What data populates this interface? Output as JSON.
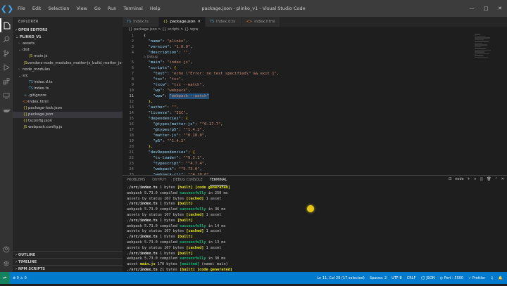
{
  "window": {
    "title": "package.json - plinko_v1 - Visual Studio Code",
    "controls": [
      "—",
      "□",
      "✕"
    ]
  },
  "menu": [
    "File",
    "Edit",
    "Selection",
    "View",
    "Go",
    "Run",
    "Terminal",
    "Help"
  ],
  "sidebar": {
    "header": "EXPLORER",
    "open_editors": "OPEN EDITORS",
    "project": "PLINKO_V1",
    "items": [
      {
        "label": "assets",
        "type": "folder",
        "open": false,
        "indent": 1
      },
      {
        "label": "dist",
        "type": "folder",
        "open": true,
        "indent": 1
      },
      {
        "label": "main.js",
        "type": "js",
        "indent": 2
      },
      {
        "label": "vendors-node_modules_matter-js_build_matter_js-node_mo...",
        "type": "js",
        "indent": 2
      },
      {
        "label": "node_modules",
        "type": "folder",
        "open": false,
        "indent": 1
      },
      {
        "label": "src",
        "type": "folder",
        "open": true,
        "indent": 1
      },
      {
        "label": "index.d.ts",
        "type": "ts",
        "indent": 2
      },
      {
        "label": "index.ts",
        "type": "ts",
        "indent": 2
      },
      {
        "label": ".gitignore",
        "type": "git",
        "indent": 1
      },
      {
        "label": "index.html",
        "type": "html",
        "indent": 1
      },
      {
        "label": "package-lock.json",
        "type": "json",
        "indent": 1
      },
      {
        "label": "package.json",
        "type": "json",
        "indent": 1,
        "selected": true
      },
      {
        "label": "tsconfig.json",
        "type": "json",
        "indent": 1
      },
      {
        "label": "webpack.config.js",
        "type": "js",
        "indent": 1
      }
    ],
    "outline": "OUTLINE",
    "timeline": "TIMELINE",
    "npm_scripts": "NPM SCRIPTS"
  },
  "tabs": [
    {
      "label": "index.ts",
      "icon": "TS",
      "active": false
    },
    {
      "label": "package.json",
      "icon": "{}",
      "active": true
    },
    {
      "label": "index.d.ts",
      "icon": "TS",
      "active": false
    },
    {
      "label": "index.html",
      "icon": "<>",
      "active": false
    }
  ],
  "breadcrumb": "{} package.json > {} scripts > {} wpw",
  "codelens": "▷ Debug",
  "code": [
    {
      "n": "1",
      "t": [
        [
          "p",
          "{"
        ]
      ]
    },
    {
      "n": "2",
      "t": [
        [
          "p",
          "  "
        ],
        [
          "k",
          "\"name\""
        ],
        [
          "p",
          ": "
        ],
        [
          "s",
          "\"plinko\""
        ],
        [
          "p",
          ","
        ]
      ]
    },
    {
      "n": "3",
      "t": [
        [
          "p",
          "  "
        ],
        [
          "k",
          "\"version\""
        ],
        [
          "p",
          ": "
        ],
        [
          "s",
          "\"1.0.0\""
        ],
        [
          "p",
          ","
        ]
      ]
    },
    {
      "n": "4",
      "t": [
        [
          "p",
          "  "
        ],
        [
          "k",
          "\"description\""
        ],
        [
          "p",
          ": "
        ],
        [
          "s",
          "\"\""
        ],
        [
          "p",
          ","
        ]
      ]
    },
    {
      "n": "5",
      "t": [
        [
          "p",
          "  "
        ],
        [
          "k",
          "\"main\""
        ],
        [
          "p",
          ": "
        ],
        [
          "s",
          "\"index.js\""
        ],
        [
          "p",
          ","
        ]
      ],
      "lens": true
    },
    {
      "n": "6",
      "t": [
        [
          "p",
          "  "
        ],
        [
          "k",
          "\"scripts\""
        ],
        [
          "p",
          ": "
        ],
        [
          "b2",
          "{"
        ]
      ]
    },
    {
      "n": "7",
      "t": [
        [
          "p",
          "    "
        ],
        [
          "k",
          "\"test\""
        ],
        [
          "p",
          ": "
        ],
        [
          "s",
          "\"echo \\\"Error: no test specified\\\" && exit 1\""
        ],
        [
          "p",
          ","
        ]
      ]
    },
    {
      "n": "8",
      "t": [
        [
          "p",
          "    "
        ],
        [
          "k",
          "\"tsc\""
        ],
        [
          "p",
          ": "
        ],
        [
          "s",
          "\"tsc\""
        ],
        [
          "p",
          ","
        ]
      ]
    },
    {
      "n": "9",
      "t": [
        [
          "p",
          "    "
        ],
        [
          "k",
          "\"tscw\""
        ],
        [
          "p",
          ": "
        ],
        [
          "s",
          "\"tsc --watch\""
        ],
        [
          "p",
          ","
        ]
      ]
    },
    {
      "n": "10",
      "t": [
        [
          "p",
          "    "
        ],
        [
          "k",
          "\"wp\""
        ],
        [
          "p",
          ": "
        ],
        [
          "s",
          "\"webpack\""
        ],
        [
          "p",
          ","
        ]
      ]
    },
    {
      "n": "11",
      "t": [
        [
          "p",
          "    "
        ],
        [
          "k",
          "\"wpw\""
        ],
        [
          "p",
          ": "
        ],
        [
          "sel",
          "\"webpack --watch\""
        ]
      ],
      "cur": true
    },
    {
      "n": "12",
      "t": [
        [
          "p",
          "  "
        ],
        [
          "b2",
          "}"
        ],
        [
          "p",
          ","
        ]
      ]
    },
    {
      "n": "13",
      "t": [
        [
          "p",
          "  "
        ],
        [
          "k",
          "\"author\""
        ],
        [
          "p",
          ": "
        ],
        [
          "s",
          "\"\""
        ],
        [
          "p",
          ","
        ]
      ]
    },
    {
      "n": "14",
      "t": [
        [
          "p",
          "  "
        ],
        [
          "k",
          "\"license\""
        ],
        [
          "p",
          ": "
        ],
        [
          "s",
          "\"ISC\""
        ],
        [
          "p",
          ","
        ]
      ]
    },
    {
      "n": "15",
      "t": [
        [
          "p",
          "  "
        ],
        [
          "k",
          "\"dependencies\""
        ],
        [
          "p",
          ": "
        ],
        [
          "b2",
          "{"
        ]
      ]
    },
    {
      "n": "16",
      "t": [
        [
          "p",
          "    "
        ],
        [
          "k",
          "\"@types/matter-js\""
        ],
        [
          "p",
          ": "
        ],
        [
          "s",
          "\"^0.17.7\""
        ],
        [
          "p",
          ","
        ]
      ]
    },
    {
      "n": "17",
      "t": [
        [
          "p",
          "    "
        ],
        [
          "k",
          "\"@types/p5\""
        ],
        [
          "p",
          ": "
        ],
        [
          "s",
          "\"^1.4.2\""
        ],
        [
          "p",
          ","
        ]
      ]
    },
    {
      "n": "18",
      "t": [
        [
          "p",
          "    "
        ],
        [
          "k",
          "\"matter-js\""
        ],
        [
          "p",
          ": "
        ],
        [
          "s",
          "\"^0.18.0\""
        ],
        [
          "p",
          ","
        ]
      ]
    },
    {
      "n": "19",
      "t": [
        [
          "p",
          "    "
        ],
        [
          "k",
          "\"p5\""
        ],
        [
          "p",
          ": "
        ],
        [
          "s",
          "\"^1.4.2\""
        ]
      ]
    },
    {
      "n": "20",
      "t": [
        [
          "p",
          "  "
        ],
        [
          "b2",
          "}"
        ],
        [
          "p",
          ","
        ]
      ]
    },
    {
      "n": "21",
      "t": [
        [
          "p",
          "  "
        ],
        [
          "k",
          "\"devDependencies\""
        ],
        [
          "p",
          ": "
        ],
        [
          "b2",
          "{"
        ]
      ]
    },
    {
      "n": "22",
      "t": [
        [
          "p",
          "    "
        ],
        [
          "k",
          "\"ts-loader\""
        ],
        [
          "p",
          ": "
        ],
        [
          "s",
          "\"^9.3.1\""
        ],
        [
          "p",
          ","
        ]
      ]
    },
    {
      "n": "23",
      "t": [
        [
          "p",
          "    "
        ],
        [
          "k",
          "\"typescript\""
        ],
        [
          "p",
          ": "
        ],
        [
          "s",
          "\"^4.7.4\""
        ],
        [
          "p",
          ","
        ]
      ]
    },
    {
      "n": "24",
      "t": [
        [
          "p",
          "    "
        ],
        [
          "k",
          "\"webpack\""
        ],
        [
          "p",
          ": "
        ],
        [
          "s",
          "\"^5.73.0\""
        ],
        [
          "p",
          ","
        ]
      ]
    },
    {
      "n": "25",
      "t": [
        [
          "p",
          "    "
        ],
        [
          "k",
          "\"webpack-cli\""
        ],
        [
          "p",
          ": "
        ],
        [
          "s",
          "\"^4.10.0\""
        ]
      ]
    },
    {
      "n": "26",
      "t": [
        [
          "p",
          "  "
        ],
        [
          "b2",
          "}"
        ]
      ]
    },
    {
      "n": "27",
      "t": [
        [
          "p",
          "}"
        ]
      ]
    }
  ],
  "panel": {
    "tabs": [
      "PROBLEMS",
      "OUTPUT",
      "DEBUG CONSOLE",
      "TERMINAL"
    ],
    "active": "TERMINAL",
    "shell": "node",
    "actions": [
      "+",
      "∨",
      "◫",
      "🗑",
      "⌃",
      "✕"
    ]
  },
  "terminal": [
    [
      [
        "bold",
        "./src/index.ts"
      ],
      [
        "n",
        " 1 bytes "
      ],
      [
        "yel",
        "[built]"
      ],
      [
        "n",
        " "
      ],
      [
        "yel",
        "[code generated]"
      ]
    ],
    [
      [
        "n",
        "webpack 5.73.0 compiled "
      ],
      [
        "grn",
        "successfully"
      ],
      [
        "n",
        " in 250 ms"
      ]
    ],
    [
      [
        "n",
        "assets by status 167 bytes "
      ],
      [
        "yel",
        "[cached]"
      ],
      [
        "n",
        " 1 asset"
      ]
    ],
    [
      [
        "bold",
        "./src/index.ts"
      ],
      [
        "n",
        " 1 bytes "
      ],
      [
        "yel",
        "[built]"
      ]
    ],
    [
      [
        "n",
        "webpack 5.73.0 compiled "
      ],
      [
        "grn",
        "successfully"
      ],
      [
        "n",
        " in 36 ms"
      ]
    ],
    [
      [
        "n",
        "assets by status 167 bytes "
      ],
      [
        "yel",
        "[cached]"
      ],
      [
        "n",
        " 1 asset"
      ]
    ],
    [
      [
        "bold",
        "./src/index.ts"
      ],
      [
        "n",
        " 1 bytes "
      ],
      [
        "yel",
        "[built]"
      ]
    ],
    [
      [
        "n",
        "webpack 5.73.0 compiled "
      ],
      [
        "grn",
        "successfully"
      ],
      [
        "n",
        " in 14 ms"
      ]
    ],
    [
      [
        "n",
        "assets by status 167 bytes "
      ],
      [
        "yel",
        "[cached]"
      ],
      [
        "n",
        " 1 asset"
      ]
    ],
    [
      [
        "bold",
        "./src/index.ts"
      ],
      [
        "n",
        " 1 bytes "
      ],
      [
        "yel",
        "[built]"
      ]
    ],
    [
      [
        "n",
        "webpack 5.73.0 compiled "
      ],
      [
        "grn",
        "successfully"
      ],
      [
        "n",
        " in 13 ms"
      ]
    ],
    [
      [
        "n",
        "assets by status 167 bytes "
      ],
      [
        "yel",
        "[cached]"
      ],
      [
        "n",
        " 1 asset"
      ]
    ],
    [
      [
        "bold",
        "./src/index.ts"
      ],
      [
        "n",
        " 1 bytes "
      ],
      [
        "yel",
        "[built]"
      ]
    ],
    [
      [
        "n",
        "webpack 5.73.0 compiled "
      ],
      [
        "grn",
        "successfully"
      ],
      [
        "n",
        " in 30 ms"
      ]
    ],
    [
      [
        "n",
        "asset "
      ],
      [
        "yel",
        "main.js"
      ],
      [
        "n",
        " 170 bytes "
      ],
      [
        "grn",
        "[emitted]"
      ],
      [
        "n",
        " (name: main)"
      ]
    ],
    [
      [
        "bold",
        "./src/index.ts"
      ],
      [
        "n",
        " 21 bytes "
      ],
      [
        "yel",
        "[built]"
      ],
      [
        "n",
        " "
      ],
      [
        "yel",
        "[code generated]"
      ]
    ],
    [
      [
        "n",
        "webpack 5.73.0 compiled "
      ],
      [
        "grn",
        "successfully"
      ],
      [
        "n",
        " in 51 ms"
      ]
    ]
  ],
  "statusbar": {
    "left": [
      "⊗ 0 ⚠ 0"
    ],
    "right": [
      "Ln 11, Col 29 (17 selected)",
      "Spaces: 2",
      "UTF-8",
      "CRLF",
      "{} JSON",
      "◎ Port : 5500",
      "✓ Prettier",
      "♫",
      "🔔"
    ]
  }
}
